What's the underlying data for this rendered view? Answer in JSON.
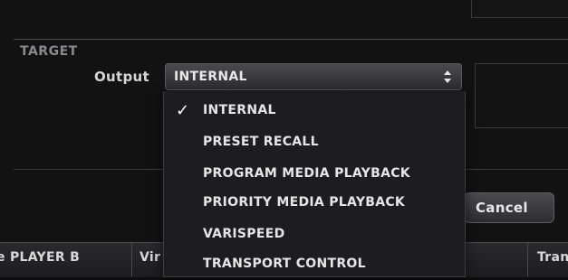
{
  "section": {
    "target_label": "TARGET"
  },
  "output": {
    "label": "Output",
    "selected": "INTERNAL"
  },
  "dropdown": {
    "items": [
      {
        "label": "INTERNAL",
        "checked": true
      },
      {
        "label": "PRESET RECALL",
        "checked": false
      },
      {
        "label": "PROGRAM MEDIA PLAYBACK",
        "checked": false
      },
      {
        "label": "PRIORITY MEDIA PLAYBACK",
        "checked": false
      },
      {
        "label": "VARISPEED",
        "checked": false
      },
      {
        "label": "TRANSPORT CONTROL",
        "checked": false
      }
    ]
  },
  "buttons": {
    "cancel": "Cancel"
  },
  "bottom_bar": {
    "col1": "e PLAYER B",
    "col2": "Vir",
    "col3": "Tran"
  },
  "icons": {
    "check": "checkmark-icon",
    "select_arrows": "updown-chevron-icon"
  }
}
